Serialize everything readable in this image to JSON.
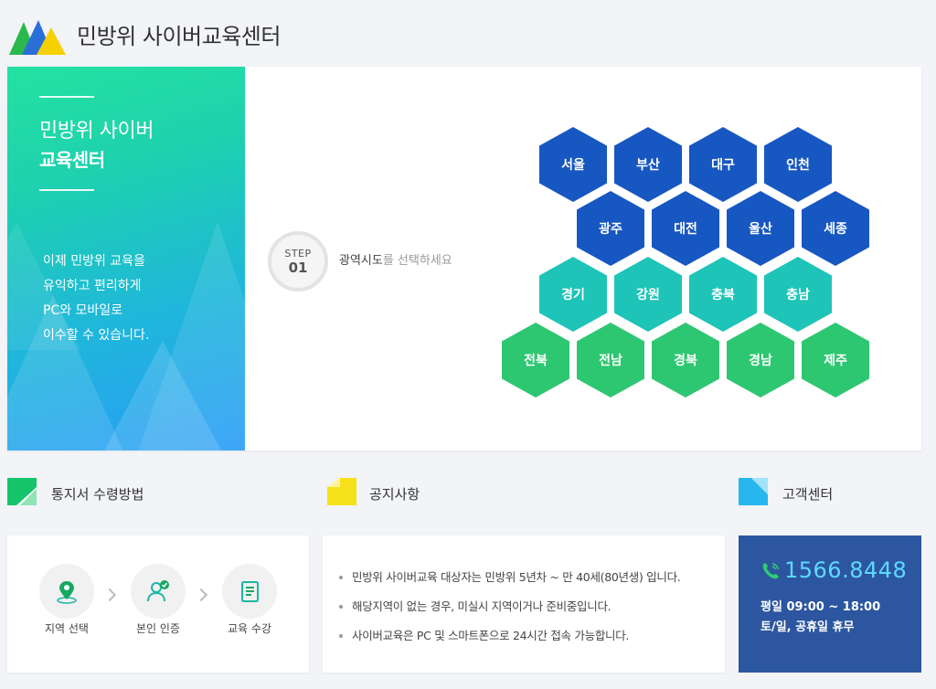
{
  "header": {
    "title": "민방위 사이버교육센터",
    "logo_colors": [
      "#2bb84c",
      "#2a6fd6",
      "#f5d100"
    ]
  },
  "hero": {
    "title_line1": "민방위 사이버",
    "title_line2": "교육센터",
    "description": [
      "이제 민방위 교육을",
      "유익하고 편리하게",
      "PC와 모바일로",
      "이수할 수 있습니다."
    ],
    "step_label": "STEP",
    "step_number": "01",
    "step_text_bold": "광역시도",
    "step_text_rest": "를 선택하세요"
  },
  "regions": {
    "row1": [
      "서울",
      "부산",
      "대구",
      "인천"
    ],
    "row2": [
      "광주",
      "대전",
      "울산",
      "세종"
    ],
    "row3": [
      "경기",
      "강원",
      "충북",
      "충남"
    ],
    "row4": [
      "전북",
      "전남",
      "경북",
      "경남",
      "제주"
    ],
    "colors": {
      "blue": "#1757c2",
      "teal": "#1ec4b7",
      "green": "#2ec771"
    }
  },
  "sections": {
    "receipt": {
      "title": "통지서 수령방법",
      "steps": [
        "지역 선택",
        "본인 인증",
        "교육 수강"
      ]
    },
    "notice": {
      "title": "공지사항",
      "items": [
        "민방위 사이버교육 대상자는 민방위 5년차 ~ 만 40세(80년생) 입니다.",
        "해당지역이 없는 경우, 미실시 지역이거나 준비중입니다.",
        "사이버교육은 PC 및 스마트폰으로 24시간 접속 가능합니다."
      ]
    },
    "support": {
      "title": "고객센터",
      "phone": "1566.8448",
      "hours_weekday": "평일 09:00 ~ 18:00",
      "hours_weekend": "토/일, 공휴일 휴무"
    }
  }
}
